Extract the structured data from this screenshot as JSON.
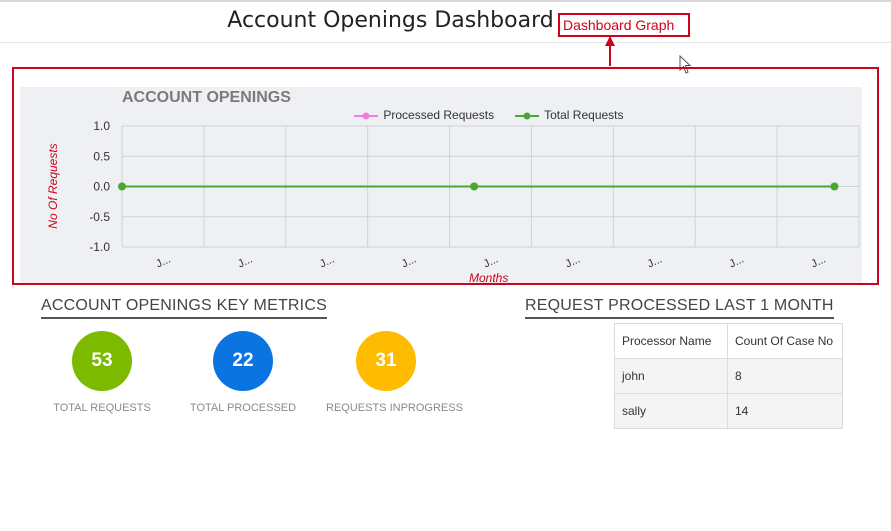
{
  "page": {
    "title": "Account Openings Dashboard"
  },
  "annotation": {
    "label": "Dashboard Graph",
    "color": "#d0021b"
  },
  "chart_data": {
    "type": "line",
    "title": "ACCOUNT OPENINGS",
    "xlabel": "Months",
    "ylabel": "No Of Requests",
    "ylim": [
      -1.0,
      1.0
    ],
    "y_ticks": [
      "1.0",
      "0.5",
      "0.0",
      "-0.5",
      "-1.0"
    ],
    "x_tick_labels": [
      "J...",
      "J...",
      "J...",
      "J...",
      "J...",
      "J...",
      "J...",
      "J...",
      "J..."
    ],
    "grid": true,
    "legend_position": "top-center",
    "series": [
      {
        "name": "Processed Requests",
        "color": "#f07ee0",
        "points": [],
        "visible": false
      },
      {
        "name": "Total Requests",
        "color": "#4aa832",
        "points": [
          [
            0,
            0
          ],
          [
            4.3,
            0
          ],
          [
            8.7,
            0
          ]
        ],
        "visible": true
      }
    ]
  },
  "metrics": {
    "title": "ACCOUNT OPENINGS KEY METRICS",
    "items": [
      {
        "value": "53",
        "label": "TOTAL REQUESTS",
        "color": "#7cba00"
      },
      {
        "value": "22",
        "label": "TOTAL PROCESSED",
        "color": "#0a74e0"
      },
      {
        "value": "31",
        "label": "REQUESTS INPROGRESS",
        "color": "#ffbb00"
      }
    ]
  },
  "processed": {
    "title": "REQUEST PROCESSED LAST 1 MONTH",
    "columns": [
      "Processor Name",
      "Count Of Case No"
    ],
    "rows": [
      [
        "john",
        "8"
      ],
      [
        "sally",
        "14"
      ]
    ]
  }
}
